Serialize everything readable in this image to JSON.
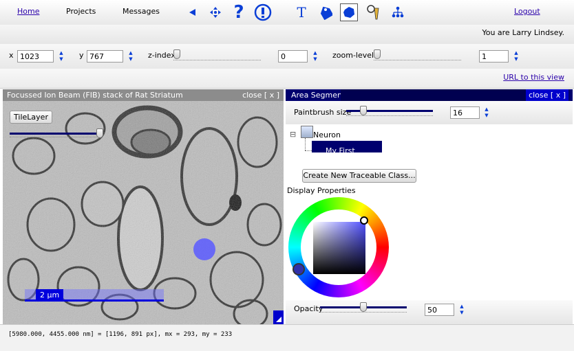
{
  "menu": {
    "home": "Home",
    "projects": "Projects",
    "messages": "Messages",
    "logout": "Logout"
  },
  "tools": [
    {
      "icon": "back-arrow-icon",
      "glyph": "◀"
    },
    {
      "icon": "move-crosshair-icon",
      "glyph": "✥"
    },
    {
      "icon": "help-icon",
      "glyph": "?"
    },
    {
      "icon": "alert-icon",
      "glyph": "!"
    },
    {
      "icon": "text-tool-icon",
      "glyph": "T"
    },
    {
      "icon": "tag-icon",
      "glyph": "🏷"
    },
    {
      "icon": "area-segment-icon",
      "glyph": "⬢"
    },
    {
      "icon": "pen-tool-icon",
      "glyph": "✎"
    },
    {
      "icon": "tree-icon",
      "glyph": "⋔"
    }
  ],
  "user": {
    "greeting": "You are Larry Lindsey."
  },
  "nav": {
    "x_label": "x",
    "x_value": "1023",
    "y_label": "y",
    "y_value": "767",
    "z_label": "z-index",
    "z_value": "0",
    "z_level": 0,
    "zoom_label": "zoom-level",
    "zoom_value": "1",
    "zoom_level": 0
  },
  "url_link": "URL to this view",
  "stack_panel": {
    "title": "Focussed Ion Beam (FIB) stack of Rat Striatum",
    "close": "close [ x ]",
    "tilelayer_button": "TileLayer",
    "opacity_level": 1.0,
    "scalebar": "2 µm"
  },
  "segment_panel": {
    "title": "Area Segment",
    "close": "close [ x ]",
    "brush_label": "Paintbrush size",
    "brush_value": "16",
    "brush_level": 0.17,
    "tree_root": "Neuron",
    "tree_root_toggle": "⊟",
    "tree_child": "My First Neuron",
    "create_button": "Create New Traceable Class...",
    "display_props": "Display Properties",
    "opacity_label": "Opacity",
    "opacity_value": "50",
    "opacity_level": 0.5
  },
  "status": {
    "text": "[5980.000, 4455.000 nm] = [1196, 891 px], mx = 293, my = 233"
  },
  "colors": {
    "accent_blue": "#00006e",
    "link": "#2a00aa",
    "icon_blue": "#0b3fd6",
    "brush": "#5b5bff"
  }
}
